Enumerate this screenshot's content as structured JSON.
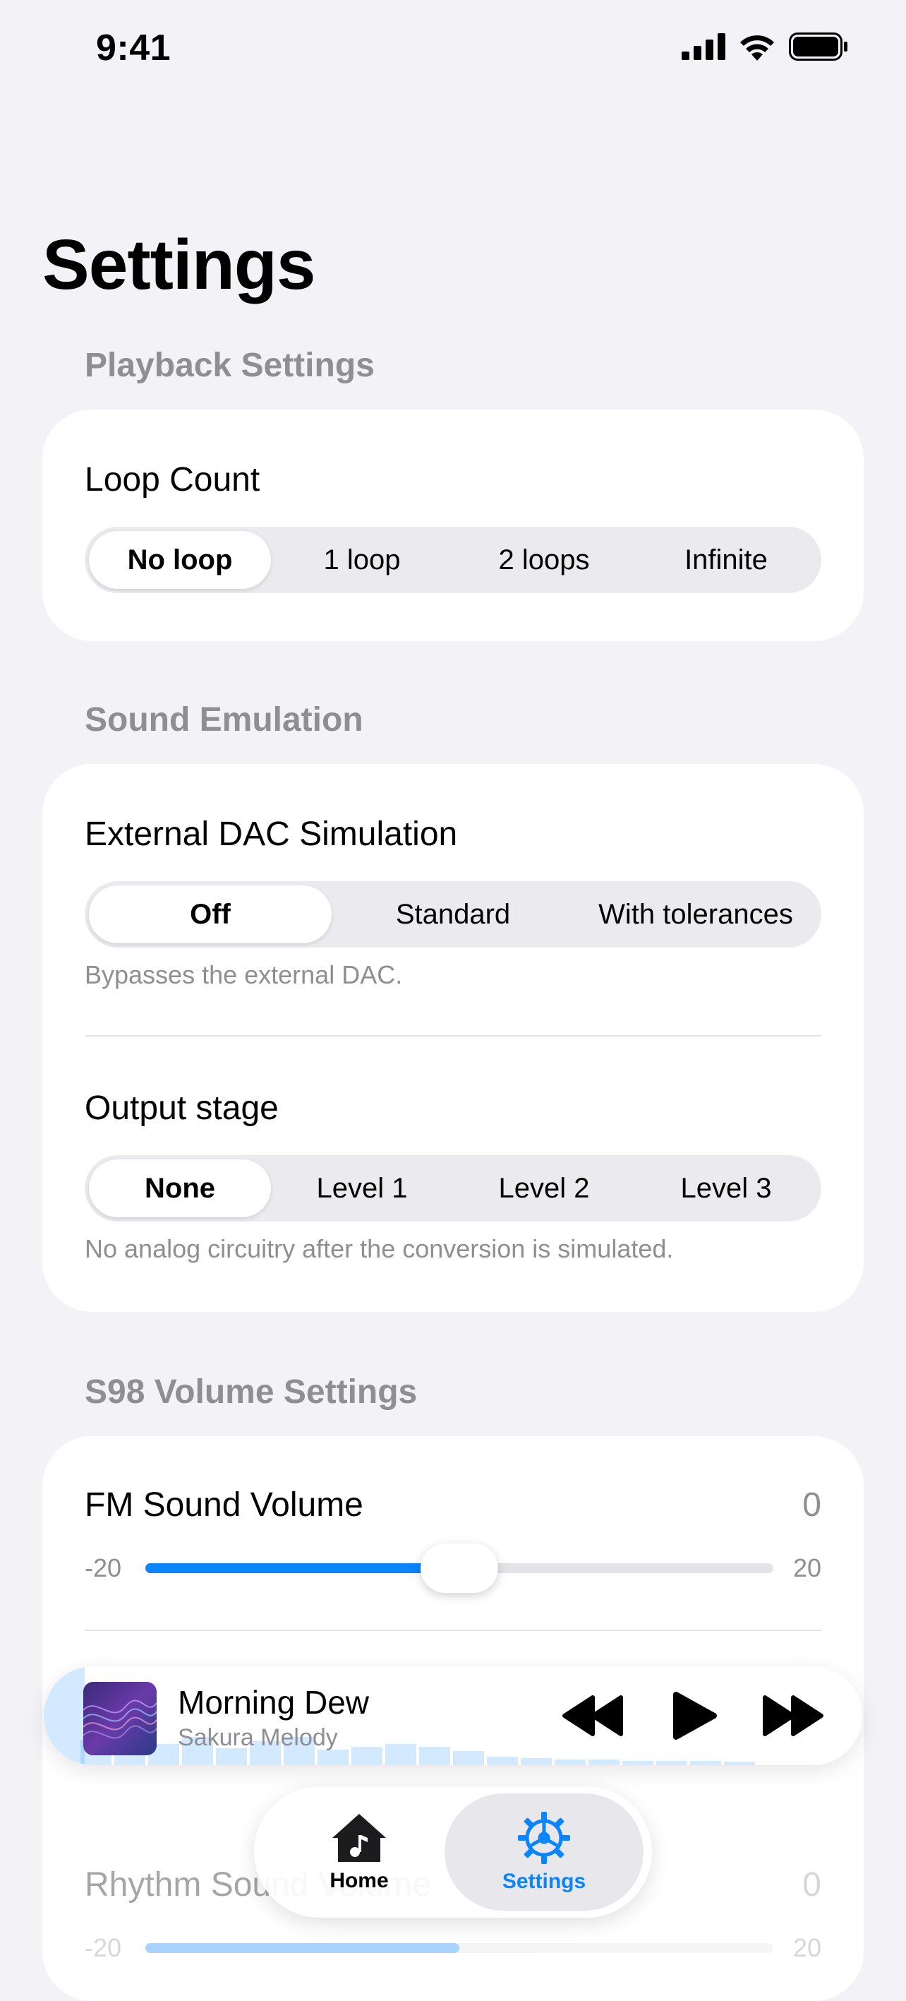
{
  "status_bar": {
    "time": "9:41",
    "icons": [
      "cellular-signal-icon",
      "wifi-icon",
      "battery-icon"
    ]
  },
  "page_title": "Settings",
  "playback": {
    "header": "Playback Settings",
    "loop_count": {
      "label": "Loop Count",
      "options": [
        "No loop",
        "1 loop",
        "2 loops",
        "Infinite"
      ],
      "selected": "No loop"
    }
  },
  "sound_emulation": {
    "header": "Sound Emulation",
    "dac": {
      "label": "External DAC Simulation",
      "options": [
        "Off",
        "Standard",
        "With tolerances"
      ],
      "selected": "Off",
      "hint": "Bypasses the external DAC."
    },
    "output_stage": {
      "label": "Output stage",
      "options": [
        "None",
        "Level 1",
        "Level 2",
        "Level 3"
      ],
      "selected": "None",
      "hint": "No analog circuitry after the conversion is simulated."
    }
  },
  "volume": {
    "header": "S98 Volume Settings",
    "fm": {
      "label": "FM Sound Volume",
      "value": "0",
      "min": "-20",
      "max": "20",
      "level": 0.5
    },
    "rhythm": {
      "label": "Rhythm Sound Volume",
      "value": "0",
      "min": "-20",
      "max": "20",
      "level": 0.5
    }
  },
  "player": {
    "title": "Morning Dew",
    "artist": "Sakura Melody",
    "progress": 0.03,
    "controls": [
      "rewind-icon",
      "play-icon",
      "fast-forward-icon"
    ]
  },
  "tabbar": {
    "tabs": [
      {
        "label": "Home",
        "icon": "home-music-icon"
      },
      {
        "label": "Settings",
        "icon": "gear-icon"
      }
    ],
    "selected": "Settings"
  },
  "colors": {
    "accent": "#0a84ff",
    "background": "#f2f2f7",
    "secondary_text": "#8e8e93"
  }
}
